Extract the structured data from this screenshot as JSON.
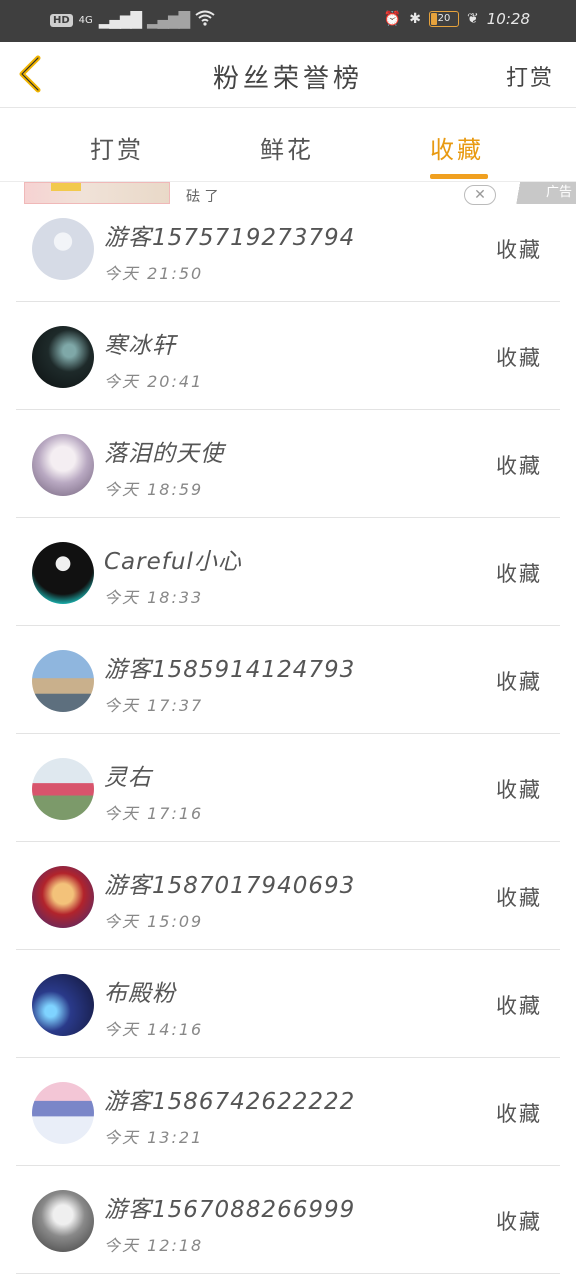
{
  "status_bar": {
    "network_badge": "HD",
    "network_type": "4G",
    "battery": "20",
    "time": "10:28"
  },
  "header": {
    "title": "粉丝荣誉榜",
    "action": "打赏",
    "back_icon": "chevron-left-icon",
    "accent_color": "#f0b400"
  },
  "tabs": [
    {
      "label": "打赏"
    },
    {
      "label": "鲜花"
    },
    {
      "label": "收藏"
    }
  ],
  "active_tab_color": "#e89a12",
  "ad": {
    "text": "砝 了",
    "badge": "广告"
  },
  "fans": [
    {
      "name": "游客1575719273794",
      "time": "今天  21:50",
      "action": "收藏"
    },
    {
      "name": "寒冰轩",
      "time": "今天  20:41",
      "action": "收藏"
    },
    {
      "name": "落泪的天使",
      "time": "今天  18:59",
      "action": "收藏"
    },
    {
      "name": "Careful小心",
      "time": "今天  18:33",
      "action": "收藏"
    },
    {
      "name": "游客1585914124793",
      "time": "今天  17:37",
      "action": "收藏"
    },
    {
      "name": "灵右",
      "time": "今天  17:16",
      "action": "收藏"
    },
    {
      "name": "游客1587017940693",
      "time": "今天  15:09",
      "action": "收藏"
    },
    {
      "name": "布殿粉",
      "time": "今天  14:16",
      "action": "收藏"
    },
    {
      "name": "游客1586742622222",
      "time": "今天  13:21",
      "action": "收藏"
    },
    {
      "name": "游客1567088266999",
      "time": "今天  12:18",
      "action": "收藏"
    }
  ]
}
